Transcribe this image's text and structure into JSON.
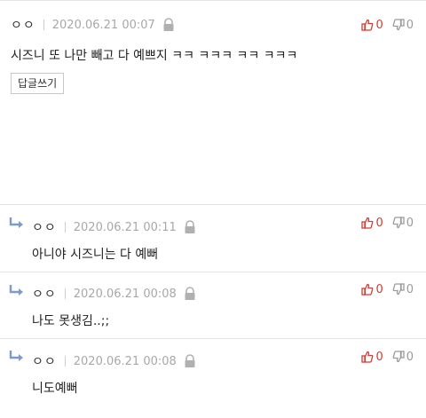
{
  "comments": [
    {
      "nick": "ㅇㅇ",
      "date": "2020.06.21 00:07",
      "text": "시즈니 또 나만 빼고 다 예쁘지 ㅋㅋ ㅋㅋㅋ ㅋㅋ ㅋㅋㅋ",
      "up": "0",
      "down": "0",
      "reply_label": "답글쓰기"
    },
    {
      "nick": "ㅇㅇ",
      "date": "2020.06.21 00:11",
      "text": "아니야 시즈니는 다 예뻐",
      "up": "0",
      "down": "0"
    },
    {
      "nick": "ㅇㅇ",
      "date": "2020.06.21 00:08",
      "text": "나도 못생김..;;",
      "up": "0",
      "down": "0"
    },
    {
      "nick": "ㅇㅇ",
      "date": "2020.06.21 00:08",
      "text": "니도예뻐",
      "up": "0",
      "down": "0"
    }
  ],
  "icons": {
    "lock": "lock-icon",
    "thumb_up": "thumbs-up-icon",
    "thumb_down": "thumbs-down-icon",
    "reply": "reply-arrow-icon"
  },
  "colors": {
    "up_vote": "#d33b33",
    "down_vote": "#9a9a9a",
    "reply_arrow": "#7b9ad0"
  }
}
